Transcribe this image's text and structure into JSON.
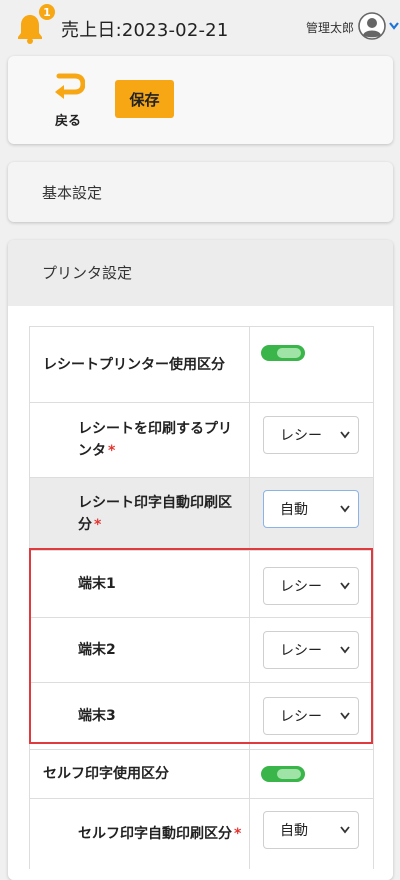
{
  "header": {
    "notification_count": "1",
    "sales_date": "売上日:2023-02-21",
    "user_name": "管理太郎"
  },
  "toolbar": {
    "back_label": "戻る",
    "save_label": "保存"
  },
  "sections": {
    "basic_title": "基本設定",
    "printer_title": "プリンタ設定"
  },
  "rows": [
    {
      "label": "レシートプリンター使用区分",
      "control": "toggle",
      "on": true
    },
    {
      "label": "レシートを印刷するプリンタ",
      "required": true,
      "control": "select",
      "value": "レシー"
    },
    {
      "label": "レシート印字自動印刷区分",
      "required": true,
      "control": "select",
      "value": "自動"
    },
    {
      "label": "端末1",
      "control": "select",
      "value": "レシー"
    },
    {
      "label": "端末2",
      "control": "select",
      "value": "レシー"
    },
    {
      "label": "端末3",
      "control": "select",
      "value": "レシー"
    },
    {
      "label": "セルフ印字使用区分",
      "control": "toggle",
      "on": true
    },
    {
      "label": "セルフ印字自動印刷区分",
      "required": true,
      "control": "select",
      "value": "自動"
    }
  ],
  "required_mark": "*",
  "colors": {
    "accent": "#f7a713",
    "toggle_on": "#39b54a",
    "required": "#e3342f",
    "highlight": "#e0393e"
  }
}
